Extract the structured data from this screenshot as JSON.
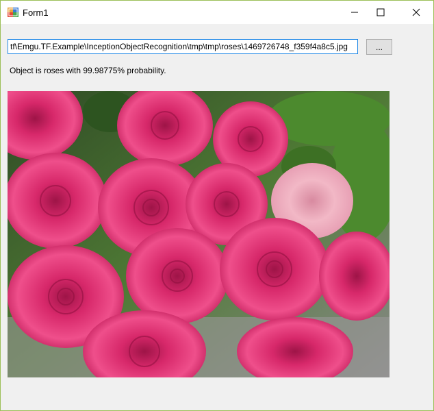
{
  "window": {
    "title": "Form1",
    "icon": "winforms-app-icon",
    "controls": {
      "minimize": "minimize-icon",
      "maximize": "maximize-icon",
      "close": "close-icon"
    }
  },
  "form": {
    "file_path": "tf\\Emgu.TF.Example\\InceptionObjectRecognition\\tmp\\tmp\\roses\\1469726748_f359f4a8c5.jpg",
    "browse_label": "...",
    "result_text": "Object is roses with 99.98775% probability.",
    "image_subject": "pink-roses-photo"
  },
  "colors": {
    "input_focus_border": "#1c86e6",
    "form_background": "#f0f0f0",
    "window_border": "#9bbf57"
  }
}
